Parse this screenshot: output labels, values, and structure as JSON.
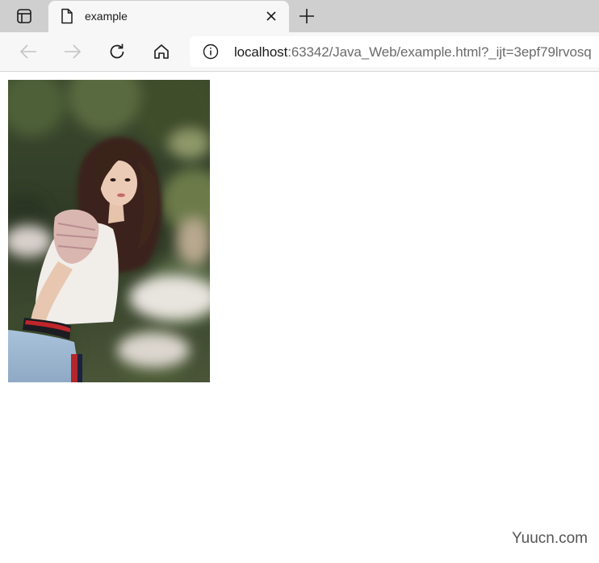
{
  "browser": {
    "tab": {
      "title": "example",
      "page_icon": "document-icon",
      "close_icon": "close-icon"
    },
    "new_tab_icon": "plus-icon",
    "tab_actions_icon": "tab-actions-icon",
    "toolbar": {
      "back_icon": "back-arrow-icon",
      "forward_icon": "forward-arrow-icon",
      "reload_icon": "reload-icon",
      "home_icon": "home-icon"
    },
    "address": {
      "info_icon": "info-icon",
      "host": "localhost",
      "rest": ":63342/Java_Web/example.html?_ijt=3epf79lrvosq"
    }
  },
  "content": {
    "image_subject": "photo of a young woman with long hair in a garden"
  },
  "watermark": "Yuucn.com",
  "colors": {
    "tabstrip": "#cfcfcf",
    "tab_active": "#f7f7f7",
    "toolbar": "#f7f7f7",
    "page_bg": "#ffffff"
  }
}
